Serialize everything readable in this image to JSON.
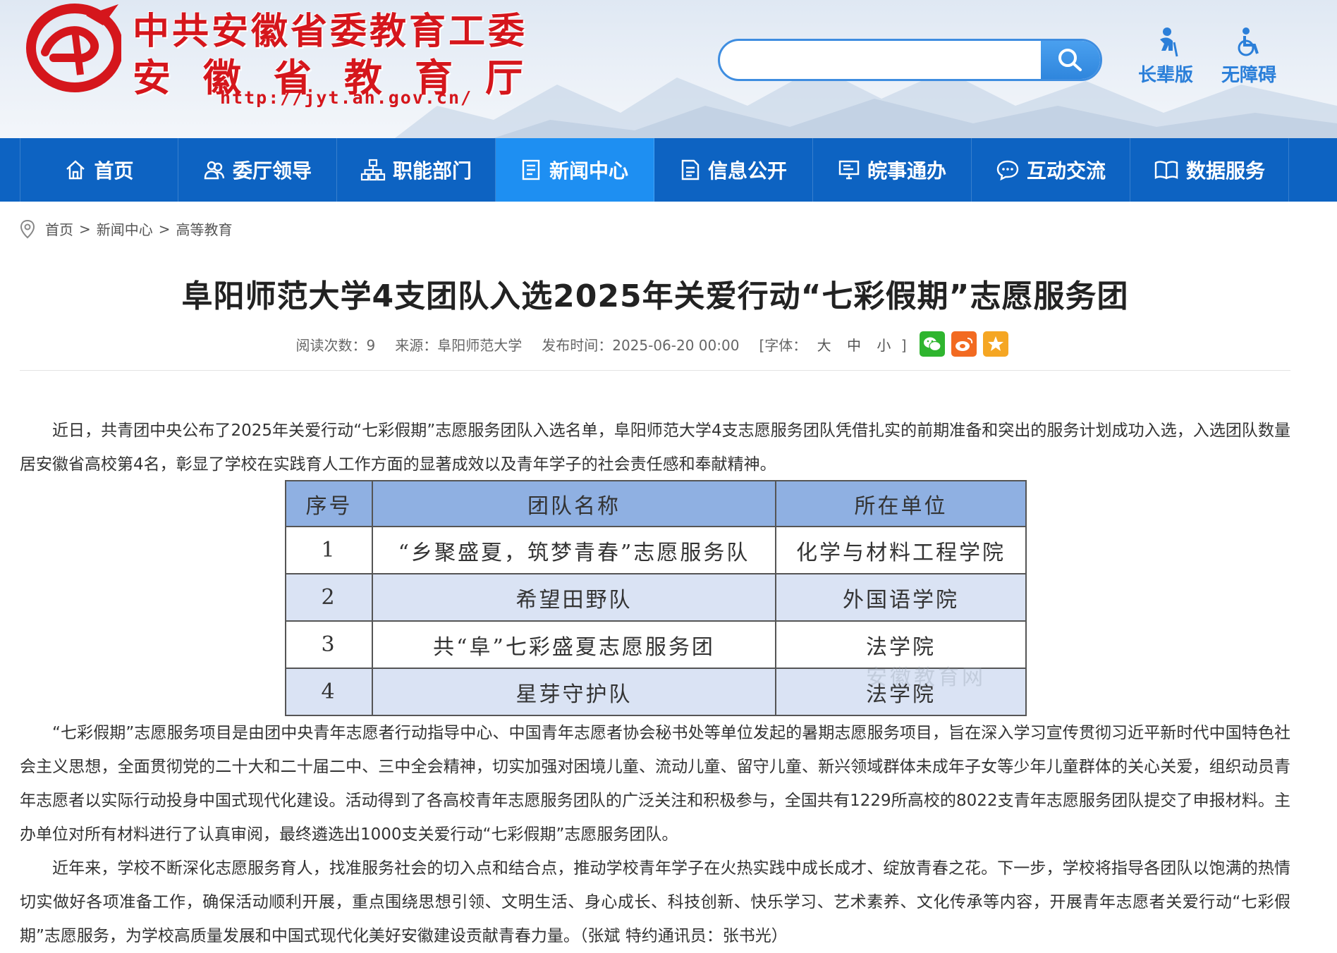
{
  "header": {
    "org_name_1": "中共安徽省委教育工委",
    "org_name_2": "安徽省教育厅",
    "url": "http://jyt.ah.gov.cn/",
    "logo_icon": "e-logo-icon",
    "search": {
      "value": "",
      "placeholder": ""
    },
    "tools": [
      {
        "label": "长辈版",
        "icon": "elder-icon"
      },
      {
        "label": "无障碍",
        "icon": "wheelchair-icon"
      }
    ],
    "colors": {
      "brand_red": "#d5161c",
      "accent_blue": "#2b7fd9"
    }
  },
  "nav": {
    "items": [
      {
        "label": "首页",
        "icon": "home-icon"
      },
      {
        "label": "委厅领导",
        "icon": "people-icon"
      },
      {
        "label": "职能部门",
        "icon": "org-chart-icon"
      },
      {
        "label": "新闻中心",
        "icon": "news-icon",
        "active": true
      },
      {
        "label": "信息公开",
        "icon": "document-icon"
      },
      {
        "label": "皖事通办",
        "icon": "monitor-icon"
      },
      {
        "label": "互动交流",
        "icon": "chat-icon"
      },
      {
        "label": "数据服务",
        "icon": "book-icon"
      }
    ],
    "colors": {
      "background": "#0d63c2",
      "active": "#1e8ff2"
    }
  },
  "breadcrumb": {
    "items": [
      "首页",
      "新闻中心",
      "高等教育"
    ],
    "separator": ">"
  },
  "article": {
    "title": "阜阳师范大学4支团队入选2025年关爱行动“七彩假期”志愿服务团",
    "meta": {
      "views_label": "阅读次数：",
      "views": "9",
      "source_label": "来源：",
      "source": "阜阳师范大学",
      "time_label": "发布时间：",
      "time": "2025-06-20 00:00",
      "font_label": "[字体：",
      "font_sizes": [
        "大",
        "中",
        "小"
      ],
      "font_close": "]"
    },
    "share": [
      {
        "icon": "wechat-icon"
      },
      {
        "icon": "weibo-icon"
      },
      {
        "icon": "favorite-star-icon"
      }
    ],
    "paragraph_1": "近日，共青团中央公布了2025年关爱行动“七彩假期”志愿服务团队入选名单，阜阳师范大学4支志愿服务团队凭借扎实的前期准备和突出的服务计划成功入选，入选团队数量居安徽省高校第4名，彰显了学校在实践育人工作方面的显著成效以及青年学子的社会责任感和奉献精神。",
    "paragraph_2": "“七彩假期”志愿服务项目是由团中央青年志愿者行动指导中心、中国青年志愿者协会秘书处等单位发起的暑期志愿服务项目，旨在深入学习宣传贯彻习近平新时代中国特色社会主义思想，全面贯彻党的二十大和二十届二中、三中全会精神，切实加强对困境儿童、流动儿童、留守儿童、新兴领域群体未成年子女等少年儿童群体的关心关爱，组织动员青年志愿者以实际行动投身中国式现代化建设。活动得到了各高校青年志愿服务团队的广泛关注和积极参与，全国共有1229所高校的8022支青年志愿服务团队提交了申报材料。主办单位对所有材料进行了认真审阅，最终遴选出1000支关爱行动“七彩假期”志愿服务团队。",
    "paragraph_3": "近年来，学校不断深化志愿服务育人，找准服务社会的切入点和结合点，推动学校青年学子在火热实践中成长成才、绽放青春之花。下一步，学校将指导各团队以饱满的热情切实做好各项准备工作，确保活动顺利开展，重点围绕思想引领、文明生活、身心成长、科技创新、快乐学习、艺术素养、文化传承等内容，开展青年志愿者关爱行动“七彩假期”志愿服务，为学校高质量发展和中国式现代化美好安徽建设贡献青春力量。（张斌 特约通讯员：张书光）",
    "table": {
      "headers": [
        "序号",
        "团队名称",
        "所在单位"
      ],
      "rows": [
        [
          "1",
          "“乡聚盛夏，筑梦青春”志愿服务队",
          "化学与材料工程学院"
        ],
        [
          "2",
          "希望田野队",
          "外国语学院"
        ],
        [
          "3",
          "共“阜”七彩盛夏志愿服务团",
          "法学院"
        ],
        [
          "4",
          "星芽守护队",
          "法学院"
        ]
      ],
      "watermark": "安徽教育网",
      "colors": {
        "header": "#8fb0e2",
        "stripe": "#dae3f4"
      }
    }
  }
}
